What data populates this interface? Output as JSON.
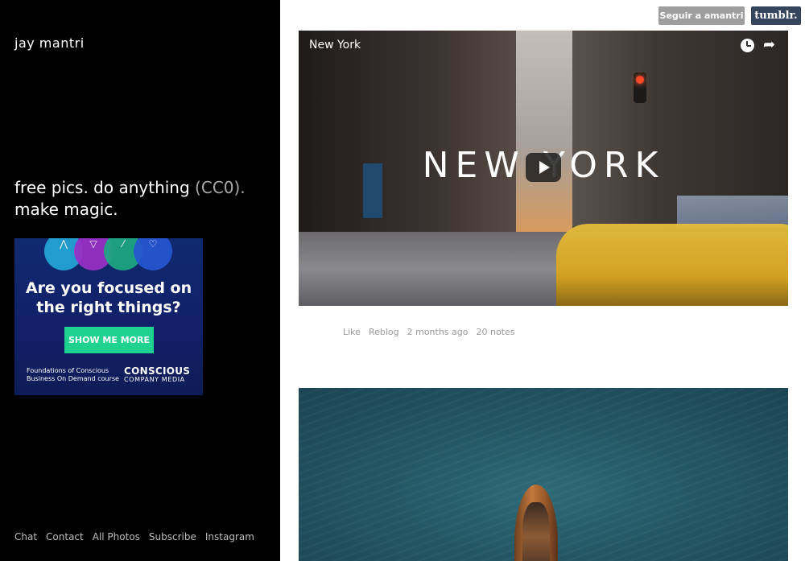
{
  "sidebar": {
    "blog_title": "jay mantri",
    "tagline_line1_prefix": "free pics. do anything ",
    "tagline_cc0": "(CC0).",
    "tagline_line2": "make magic.",
    "nav": [
      {
        "label": "Chat"
      },
      {
        "label": "Contact"
      },
      {
        "label": "All Photos"
      },
      {
        "label": "Subscribe"
      },
      {
        "label": "Instagram"
      }
    ]
  },
  "ad": {
    "headline": "Are you focused on the right things?",
    "cta_label": "SHOW ME MORE",
    "footnote": "Foundations of Conscious Business On Demand course",
    "brand": "CONSCIOUS",
    "brand_sub": "COMPANY MEDIA",
    "circle_icons": [
      "mountain-icon",
      "funnel-icon",
      "link-icon",
      "heart-icon"
    ],
    "colors": {
      "cta": "#20d28f",
      "background": "#12206a"
    }
  },
  "header": {
    "follow_label": "Seguir a amantri",
    "tumblr_label": "tumblr."
  },
  "posts": [
    {
      "type": "video",
      "title": "New York",
      "overlay_text": "NEW YORK",
      "actions": {
        "like": "Like",
        "reblog": "Reblog",
        "time": "2 months ago",
        "notes": "20 notes"
      }
    },
    {
      "type": "photo"
    }
  ],
  "colors": {
    "sidebar_bg": "#000000",
    "tumblr_brand": "#35465c",
    "follow_btn": "#9e9e9e"
  }
}
